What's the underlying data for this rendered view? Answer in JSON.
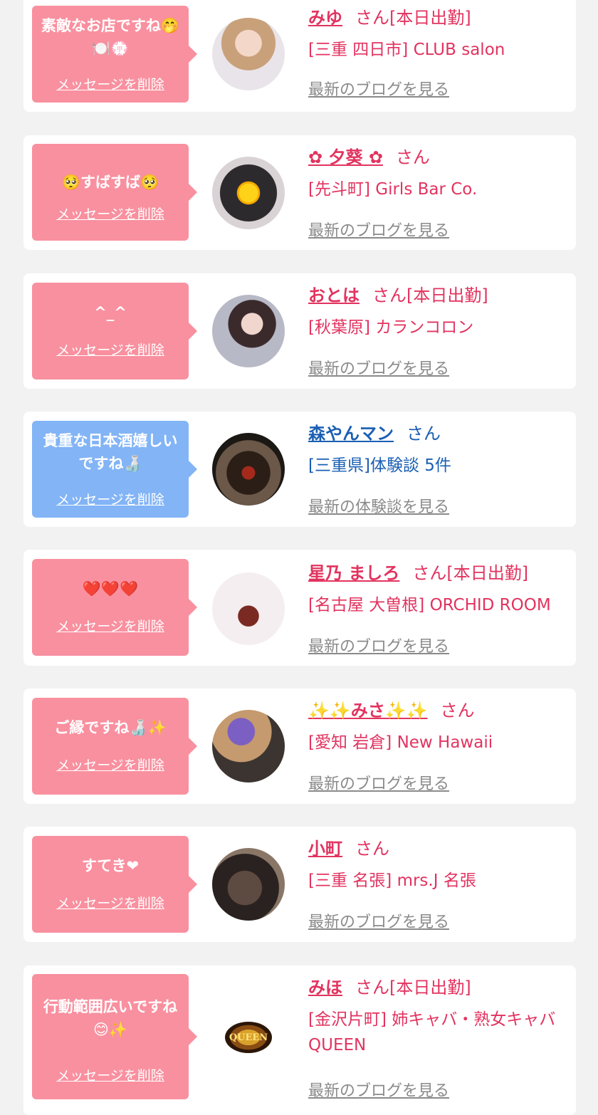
{
  "delete_label": "メッセージを削除",
  "cards": [
    {
      "message": "素敵なお店ですね🤭🍽️💮",
      "name": "みゆ",
      "san": "さん[本日出勤]",
      "shop": "[三重 四日市] CLUB salon",
      "blog": "最新のブログを見る"
    },
    {
      "message": "🥺すばすば🥺",
      "name": "✿ 夕葵 ✿",
      "san": "さん",
      "shop": "[先斗町] Girls Bar Co.",
      "blog": "最新のブログを見る"
    },
    {
      "message": "^_^",
      "name": "おとは",
      "san": "さん[本日出勤]",
      "shop": "[秋葉原] カランコロン",
      "blog": "最新のブログを見る"
    },
    {
      "message": "貴重な日本酒嬉しいですね🍶",
      "name": "森やんマン",
      "san": "さん",
      "shop": "[三重県]体験談 5件",
      "blog": "最新の体験談を見る"
    },
    {
      "message": "❤️❤️❤️",
      "name": "星乃 ましろ",
      "san": "さん[本日出勤]",
      "shop": "[名古屋 大曽根] ORCHID ROOM",
      "blog": "最新のブログを見る"
    },
    {
      "message": "ご縁ですね🍶✨",
      "name": "✨✨みさ✨✨",
      "san": "さん",
      "shop": "[愛知 岩倉] New Hawaii",
      "blog": "最新のブログを見る"
    },
    {
      "message": "すてき❤",
      "name": "小町",
      "san": "さん",
      "shop": "[三重 名張] mrs.J 名張",
      "blog": "最新のブログを見る"
    },
    {
      "message": "行動範囲広いですね😊✨",
      "name": "みほ",
      "san": "さん[本日出勤]",
      "shop": "[金沢片町] 姉キャバ・熟女キャバ QUEEN",
      "blog": "最新のブログを見る"
    }
  ],
  "avatar_logo_text": "QUEEN",
  "colors": {
    "pink_bubble": "#f9909f",
    "blue_bubble": "#82b4f6",
    "cast_text": "#e2335f",
    "user_text": "#1a5fb4",
    "blog_link": "#8a8a8a"
  }
}
